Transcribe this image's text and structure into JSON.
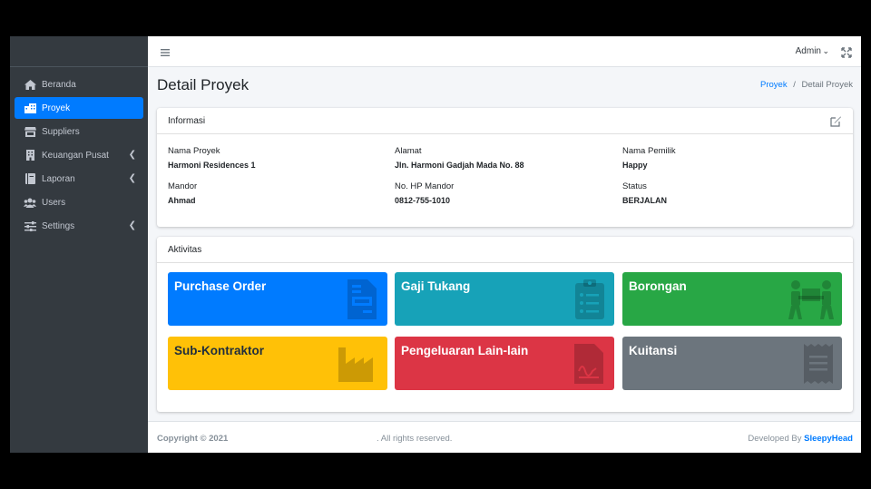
{
  "sidebar": {
    "items": [
      {
        "label": "Beranda",
        "icon": "home-icon",
        "active": false,
        "has_children": false
      },
      {
        "label": "Proyek",
        "icon": "building-icon",
        "active": true,
        "has_children": false
      },
      {
        "label": "Suppliers",
        "icon": "store-icon",
        "active": false,
        "has_children": false
      },
      {
        "label": "Keuangan Pusat",
        "icon": "building-columns-icon",
        "active": false,
        "has_children": true
      },
      {
        "label": "Laporan",
        "icon": "book-icon",
        "active": false,
        "has_children": true
      },
      {
        "label": "Users",
        "icon": "users-icon",
        "active": false,
        "has_children": false
      },
      {
        "label": "Settings",
        "icon": "sliders-icon",
        "active": false,
        "has_children": true
      }
    ]
  },
  "topbar": {
    "user": "Admin"
  },
  "page": {
    "title": "Detail Proyek",
    "breadcrumb": {
      "link": "Proyek",
      "sep": "/",
      "current": "Detail Proyek"
    }
  },
  "info": {
    "title": "Informasi",
    "fields": [
      {
        "label": "Nama Proyek",
        "value": "Harmoni Residences 1"
      },
      {
        "label": "Alamat",
        "value": "Jln. Harmoni Gadjah Mada No. 88"
      },
      {
        "label": "Nama Pemilik",
        "value": "Happy"
      },
      {
        "label": "Mandor",
        "value": "Ahmad"
      },
      {
        "label": "No. HP Mandor",
        "value": "0812-755-1010"
      },
      {
        "label": "Status",
        "value": "BERJALAN"
      }
    ]
  },
  "activity": {
    "title": "Aktivitas",
    "tiles": [
      {
        "label": "Purchase Order",
        "color": "#007bff",
        "icon": "file-invoice-icon"
      },
      {
        "label": "Gaji Tukang",
        "color": "#17a2b8",
        "icon": "clipboard-list-icon"
      },
      {
        "label": "Borongan",
        "color": "#28a745",
        "icon": "people-carry-icon"
      },
      {
        "label": "Sub-Kontraktor",
        "color": "#ffc107",
        "icon": "industry-icon"
      },
      {
        "label": "Pengeluaran Lain-lain",
        "color": "#dc3545",
        "icon": "file-signature-icon"
      },
      {
        "label": "Kuitansi",
        "color": "#6c757d",
        "icon": "receipt-icon"
      }
    ]
  },
  "footer": {
    "copyright": "Copyright © 2021",
    "rights": ". All rights reserved.",
    "dev_prefix": "Developed By",
    "dev_name": "SleepyHead"
  }
}
